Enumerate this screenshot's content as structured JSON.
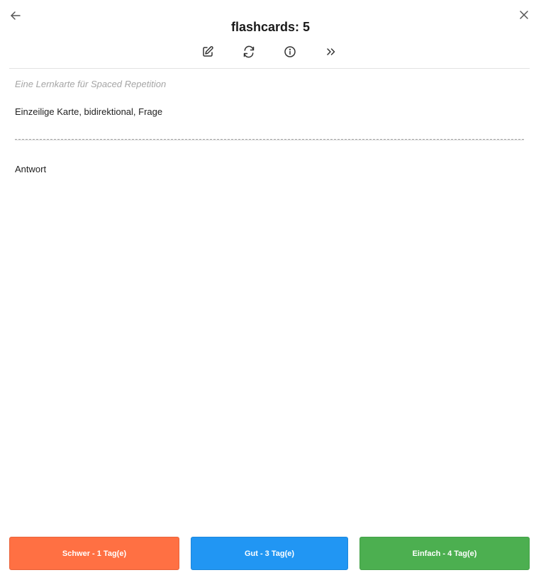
{
  "header": {
    "title": "flashcards: 5",
    "back_icon": "arrow-left-icon",
    "close_icon": "close-icon"
  },
  "toolbar": {
    "items": [
      {
        "icon": "edit-icon"
      },
      {
        "icon": "reset-icon"
      },
      {
        "icon": "info-icon"
      },
      {
        "icon": "skip-icon"
      }
    ]
  },
  "card": {
    "deck_description": "Eine Lernkarte für Spaced Repetition",
    "question": "Einzeilige Karte, bidirektional, Frage",
    "answer": "Antwort"
  },
  "rating": {
    "hard_label": "Schwer - 1 Tag(e)",
    "good_label": "Gut - 3 Tag(e)",
    "easy_label": "Einfach - 4 Tag(e)",
    "colors": {
      "hard": "#ff7043",
      "good": "#2196f3",
      "easy": "#4caf50"
    }
  }
}
